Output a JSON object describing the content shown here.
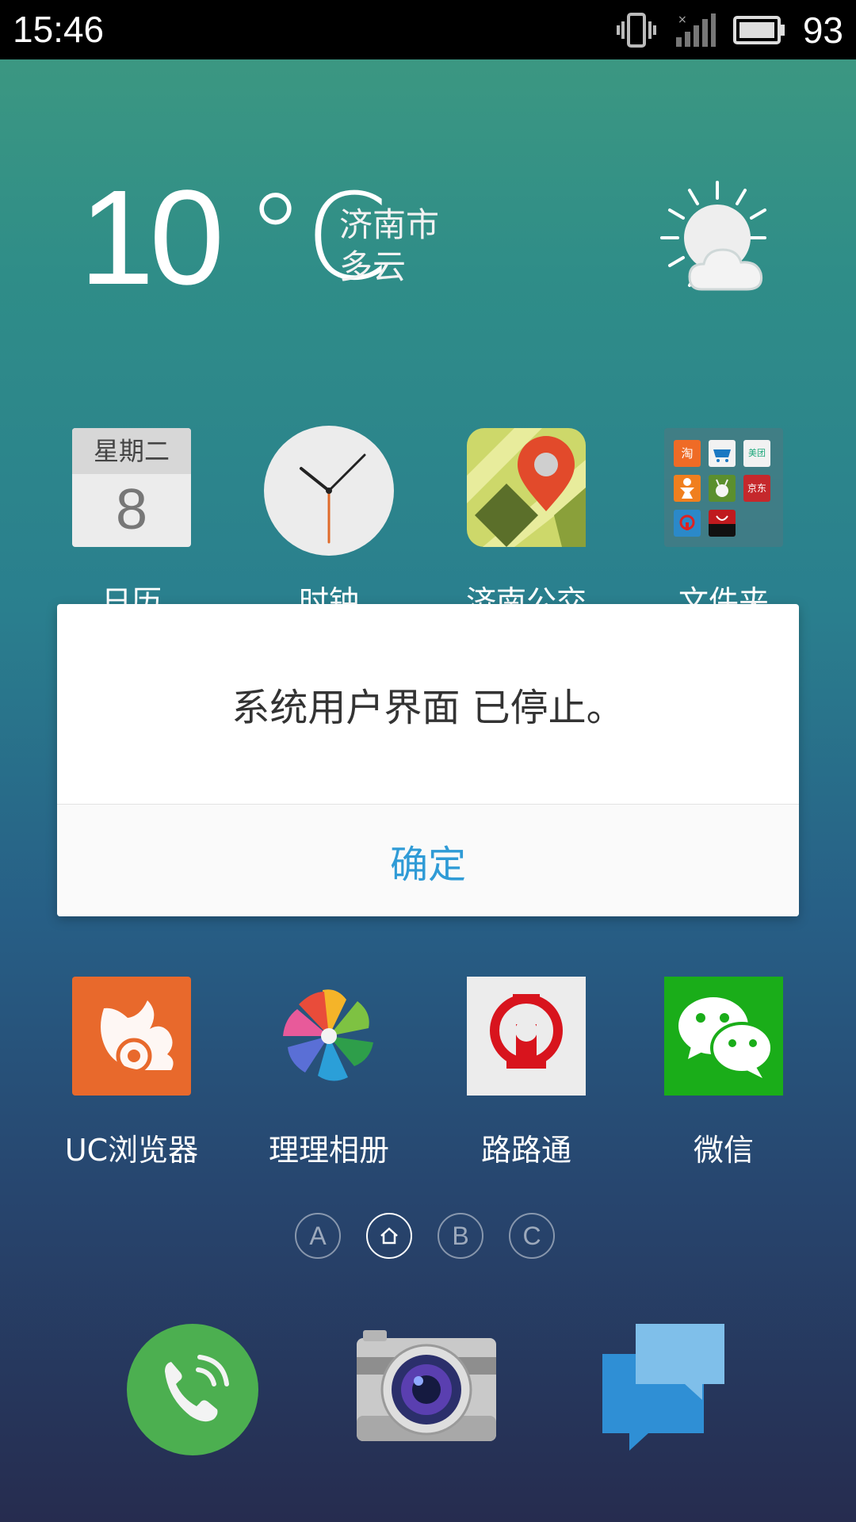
{
  "status_bar": {
    "time": "15:46",
    "battery_percent": "93",
    "icons": [
      "vibrate-icon",
      "signal-icon",
      "battery-icon"
    ]
  },
  "weather": {
    "temperature": "10",
    "unit": "°C",
    "city": "济南市",
    "condition": "多云",
    "icon": "partly-cloudy-icon"
  },
  "apps_row1": [
    {
      "label": "日历",
      "icon": "calendar-icon",
      "weekday": "星期二",
      "day": "8"
    },
    {
      "label": "时钟",
      "icon": "clock-icon"
    },
    {
      "label": "济南公交",
      "icon": "map-pin-icon"
    },
    {
      "label": "文件夹",
      "icon": "folder-icon",
      "mini_apps": [
        "淘",
        "",
        "美团",
        "",
        "",
        "京东",
        "",
        ""
      ]
    }
  ],
  "dialog": {
    "message": "系统用户界面 已停止。",
    "button_label": "确定"
  },
  "apps_row2": [
    {
      "label": "UC浏览器",
      "icon": "uc-browser-icon"
    },
    {
      "label": "理理相册",
      "icon": "pinwheel-icon"
    },
    {
      "label": "路路通",
      "icon": "railway-icon"
    },
    {
      "label": "微信",
      "icon": "wechat-icon"
    }
  ],
  "page_indicators": [
    "A",
    "home",
    "B",
    "C"
  ],
  "dock": [
    {
      "icon": "phone-icon"
    },
    {
      "icon": "camera-icon"
    },
    {
      "icon": "messages-icon"
    }
  ],
  "colors": {
    "dialog_button": "#2f9bd6",
    "wechat": "#1aad19",
    "uc": "#e8692c",
    "phone": "#4caf50",
    "messages": "#2f8fd5"
  }
}
